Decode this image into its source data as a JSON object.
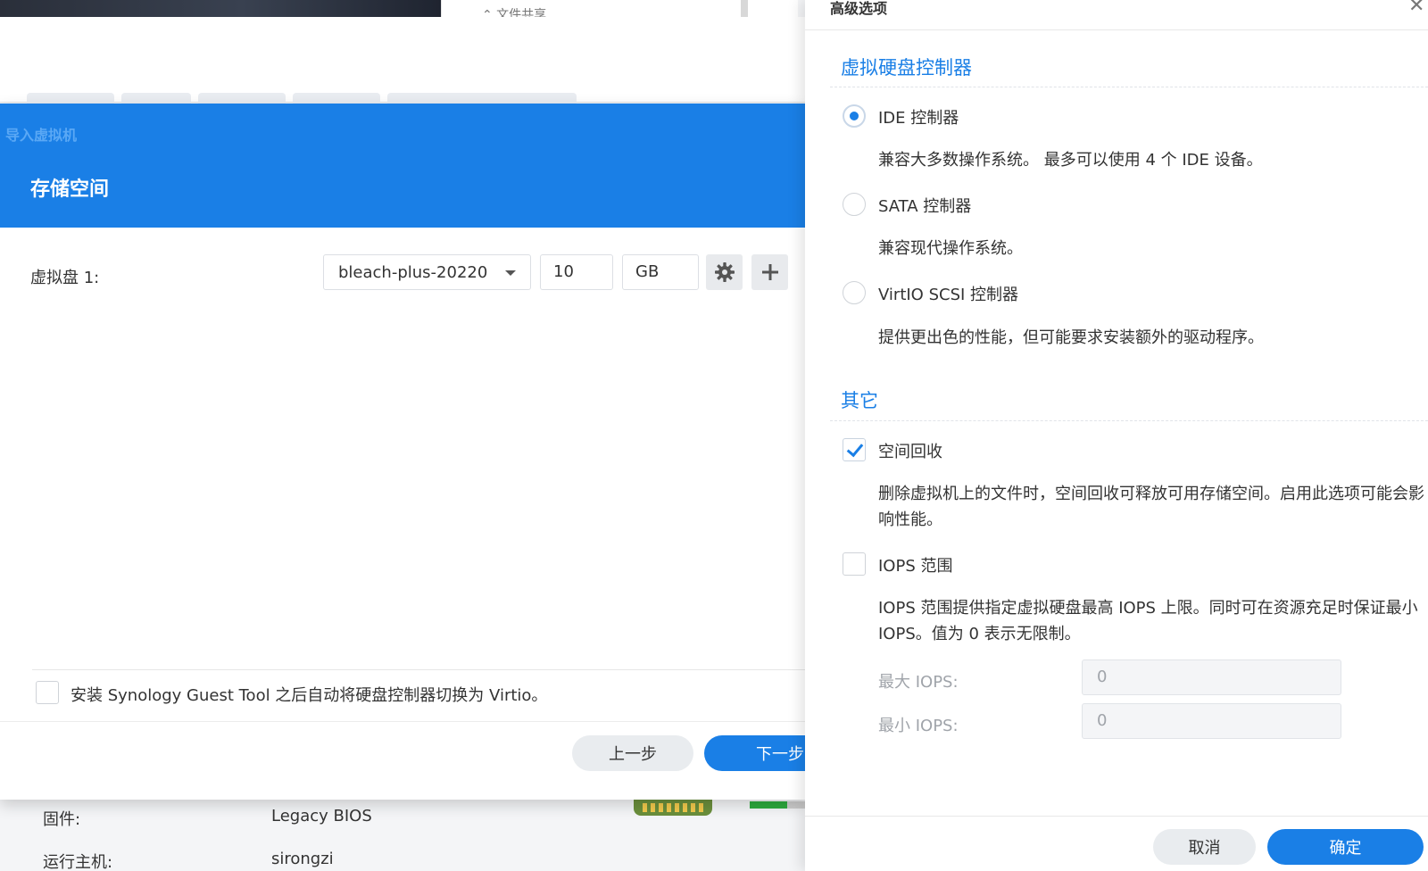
{
  "background": {
    "crumb": "⌃ 文件共享",
    "info": [
      {
        "label": "固件:",
        "value": "Legacy BIOS"
      },
      {
        "label": "运行主机:",
        "value": "sirongzi"
      }
    ]
  },
  "wizard": {
    "import_label": "导入虚拟机",
    "title": "存储空间",
    "disk_label": "虚拟盘 1:",
    "disk_select": "bleach-plus-20220",
    "size_value": "10",
    "size_unit": "GB",
    "guest_tool_label": "安装 Synology Guest Tool 之后自动将硬盘控制器切换为 Virtio。",
    "prev_label": "上一步",
    "next_label": "下一步"
  },
  "panel": {
    "title": "高级选项",
    "close": "✕",
    "section_controller": "虚拟硬盘控制器",
    "options": [
      {
        "label": "IDE 控制器",
        "desc": "兼容大多数操作系统。 最多可以使用 4 个 IDE 设备。",
        "selected": true
      },
      {
        "label": "SATA 控制器",
        "desc": "兼容现代操作系统。",
        "selected": false
      },
      {
        "label": "VirtIO SCSI 控制器",
        "desc": "提供更出色的性能，但可能要求安装额外的驱动程序。",
        "selected": false
      }
    ],
    "section_other": "其它",
    "space_reclaim": {
      "label": "空间回收",
      "desc": "删除虚拟机上的文件时，空间回收可释放可用存储空间。启用此选项可能会影响性能。",
      "checked": true
    },
    "iops": {
      "label": "IOPS 范围",
      "desc": "IOPS 范围提供指定虚拟硬盘最高 IOPS 上限。同时可在资源充足时保证最小 IOPS。值为 0 表示无限制。",
      "checked": false,
      "max_label": "最大 IOPS:",
      "max_value": "0",
      "min_label": "最小 IOPS:",
      "min_value": "0"
    },
    "cancel_label": "取消",
    "ok_label": "确定"
  },
  "colors": {
    "accent": "#1a7fe6"
  },
  "icons": {
    "gear": "gear-icon",
    "plus": "plus-icon",
    "close": "close-icon",
    "caret": "caret-down-icon"
  }
}
